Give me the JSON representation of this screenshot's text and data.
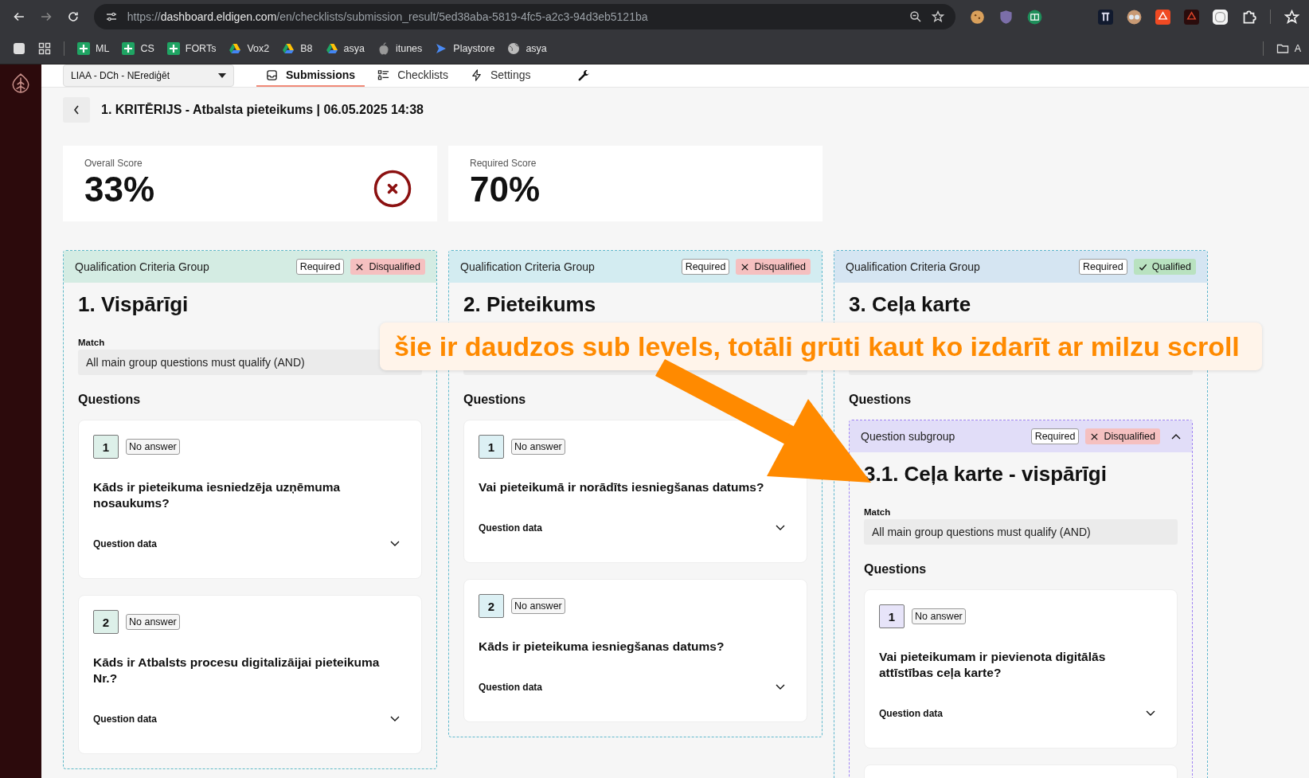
{
  "browser": {
    "url_scheme": "https://",
    "url_host": "dashboard.eldigen.com",
    "url_path": "/en/checklists/submission_result/5ed38aba-5819-4fc5-a2c3-94d3eb5121ba",
    "bookmarks": [
      {
        "label": "ML",
        "kind": "sheet"
      },
      {
        "label": "CS",
        "kind": "sheet"
      },
      {
        "label": "FORTs",
        "kind": "sheet"
      },
      {
        "label": "Vox2",
        "kind": "drive"
      },
      {
        "label": "B8",
        "kind": "drive"
      },
      {
        "label": "asya",
        "kind": "drive"
      },
      {
        "label": "itunes",
        "kind": "apple"
      },
      {
        "label": "Playstore",
        "kind": "play"
      },
      {
        "label": "asya",
        "kind": "globe"
      }
    ],
    "other_bookmarks": "A"
  },
  "nav": {
    "project": "LIAA - DCh - NErediģēt",
    "tabs": [
      {
        "label": "Submissions",
        "selected": true
      },
      {
        "label": "Checklists",
        "selected": false
      },
      {
        "label": "Settings",
        "selected": false
      }
    ]
  },
  "page_title": "1. KRITĒRIJS - Atbalsta pieteikums | 06.05.2025 14:38",
  "scores": [
    {
      "label": "Overall Score",
      "value": "33%",
      "failed": true
    },
    {
      "label": "Required Score",
      "value": "70%",
      "failed": false
    }
  ],
  "groups": [
    {
      "kind_label": "Qualification Criteria Group",
      "color": "#d4ece3",
      "required": "Required",
      "status": {
        "label": "Disqualified",
        "qualified": false
      },
      "title": "1. Vispārīgi",
      "match_label": "Match",
      "match": "All main group questions must qualify (AND)",
      "questions_heading": "Questions",
      "questions": [
        {
          "kind": "question",
          "number": "1",
          "answer": "No answer",
          "text": "Kāds ir pieteikuma iesniedzēja uzņēmuma nosaukums?",
          "data_label": "Question data",
          "expanded": false
        },
        {
          "kind": "question",
          "number": "2",
          "answer": "No answer",
          "text": "Kāds ir Atbalsts procesu digitalizāijai pieteikuma Nr.?",
          "data_label": "Question data",
          "expanded": false
        }
      ]
    },
    {
      "kind_label": "Qualification Criteria Group",
      "color": "#d3ecf1",
      "required": "Required",
      "status": {
        "label": "Disqualified",
        "qualified": false
      },
      "title": "2. Pieteikums",
      "questions_heading": "Questions",
      "questions": [
        {
          "kind": "question",
          "number": "1",
          "answer": "No answer",
          "text": "Vai pieteikumā ir norādīts iesniegšanas datums?",
          "data_label": "Question data",
          "expanded": false
        },
        {
          "kind": "question",
          "number": "2",
          "answer": "No answer",
          "text": "Kāds ir pieteikuma iesniegšanas datums?",
          "data_label": "Question data",
          "expanded": false
        }
      ]
    },
    {
      "kind_label": "Qualification Criteria Group",
      "color": "#d5e5f2",
      "required": "Required",
      "status": {
        "label": "Qualified",
        "qualified": true
      },
      "title": "3. Ceļa karte",
      "questions_heading": "Questions",
      "questions": [
        {
          "kind": "subgroup",
          "kind_label": "Question subgroup",
          "color": "#e1ddf8",
          "required": "Required",
          "status": {
            "label": "Disqualified",
            "qualified": false
          },
          "expanded": true,
          "title": "3.1. Ceļa karte - vispārīgi",
          "match_label": "Match",
          "match": "All main group questions must qualify (AND)",
          "questions_heading": "Questions",
          "questions": [
            {
              "kind": "question",
              "number": "1",
              "answer": "No answer",
              "text": "Vai pieteikumam ir pievienota digitālās attīstības ceļa karte?",
              "data_label": "Question data",
              "expanded": false
            },
            {
              "kind": "partial"
            }
          ]
        }
      ]
    }
  ],
  "annotation": {
    "text": "šie ir daudzos sub levels, totāli grūti kaut ko izdarīt ar milzu scroll"
  }
}
